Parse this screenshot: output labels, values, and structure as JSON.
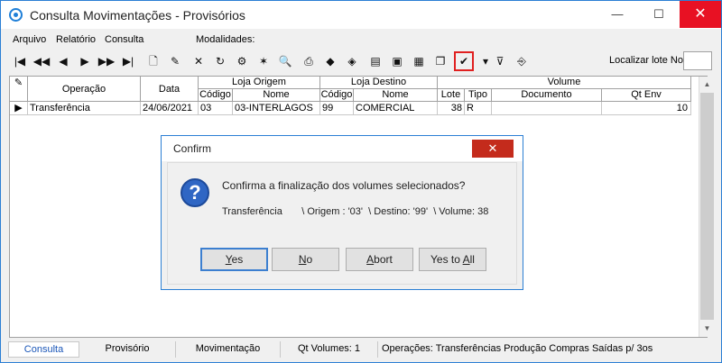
{
  "window": {
    "title": "Consulta Movimentações - Provisórios",
    "minimize": "—",
    "maximize": "☐",
    "close": "✕"
  },
  "menu": [
    {
      "label": "Arquivo"
    },
    {
      "label": "Relatório"
    },
    {
      "label": "Consulta"
    },
    {
      "label": "Modalidades:"
    }
  ],
  "toolbar": {
    "buttons": [
      {
        "icon": "first-record-icon",
        "glyph": "|◀"
      },
      {
        "icon": "prior-page-icon",
        "glyph": "◀◀"
      },
      {
        "icon": "prior-record-icon",
        "glyph": "◀"
      },
      {
        "icon": "next-record-icon",
        "glyph": "▶"
      },
      {
        "icon": "next-page-icon",
        "glyph": "▶▶"
      },
      {
        "icon": "last-record-icon",
        "glyph": "▶|"
      },
      {
        "icon": "new-document-icon",
        "glyph": "🗋"
      },
      {
        "icon": "edit-document-icon",
        "glyph": "✎"
      },
      {
        "icon": "delete-icon",
        "glyph": "✕"
      },
      {
        "icon": "refresh-icon",
        "glyph": "↻"
      },
      {
        "icon": "properties-icon",
        "glyph": "⚙"
      },
      {
        "icon": "magic-wand-icon",
        "glyph": "✶"
      },
      {
        "icon": "preview-icon",
        "glyph": "🔍"
      },
      {
        "icon": "print-icon",
        "glyph": "⎙"
      },
      {
        "icon": "tag-icon",
        "glyph": "◆"
      },
      {
        "icon": "goto-icon",
        "glyph": "◈"
      },
      {
        "icon": "filter-panel-icon",
        "glyph": "▤"
      },
      {
        "icon": "image-icon",
        "glyph": "▣"
      },
      {
        "icon": "export-icon",
        "glyph": "▦"
      },
      {
        "icon": "copy-icon",
        "glyph": "❐"
      },
      {
        "icon": "finalize-check-icon",
        "glyph": "✔"
      },
      {
        "icon": "dropdown-arrow-icon",
        "glyph": "▾"
      },
      {
        "icon": "filter-icon",
        "glyph": "⊽"
      },
      {
        "icon": "exit-door-icon",
        "glyph": "⎆"
      }
    ],
    "search_label": "Localizar lote No",
    "search_value": ""
  },
  "grid": {
    "headers": {
      "operacao": "Operação",
      "data": "Data",
      "loja_origem": "Loja Origem",
      "loja_destino": "Loja Destino",
      "volume": "Volume",
      "codigo": "Código",
      "nome": "Nome",
      "lote": "Lote",
      "tipo": "Tipo",
      "documento": "Documento",
      "qt_env": "Qt Env"
    },
    "rows": [
      {
        "operacao": "Transferência",
        "data": "24/06/2021",
        "origem_codigo": "03",
        "origem_nome": "03-INTERLAGOS",
        "destino_codigo": "99",
        "destino_nome": "COMERCIAL",
        "lote": "38",
        "tipo": "R",
        "documento": "",
        "qt_env": "10"
      }
    ]
  },
  "statusbar": {
    "tabs": [
      "Consulta",
      "Provisório",
      "Movimentação"
    ],
    "qt_volumes": "Qt Volumes: 1",
    "operacoes": "Operações:  Transferências Produção Compras Saídas p/ 3os"
  },
  "dialog": {
    "title": "Confirm",
    "close": "✕",
    "message": "Confirma a finalização dos volumes selecionados?",
    "detail": "Transferência       \\ Origem : '03'  \\ Destino: '99'  \\ Volume: 38",
    "buttons": {
      "yes_u": "Y",
      "yes_rest": "es",
      "no_u": "N",
      "no_rest": "o",
      "abort_u": "A",
      "abort_rest": "bort",
      "yestoall_pre": "Yes to ",
      "yestoall_u": "A",
      "yestoall_rest": "ll"
    }
  }
}
